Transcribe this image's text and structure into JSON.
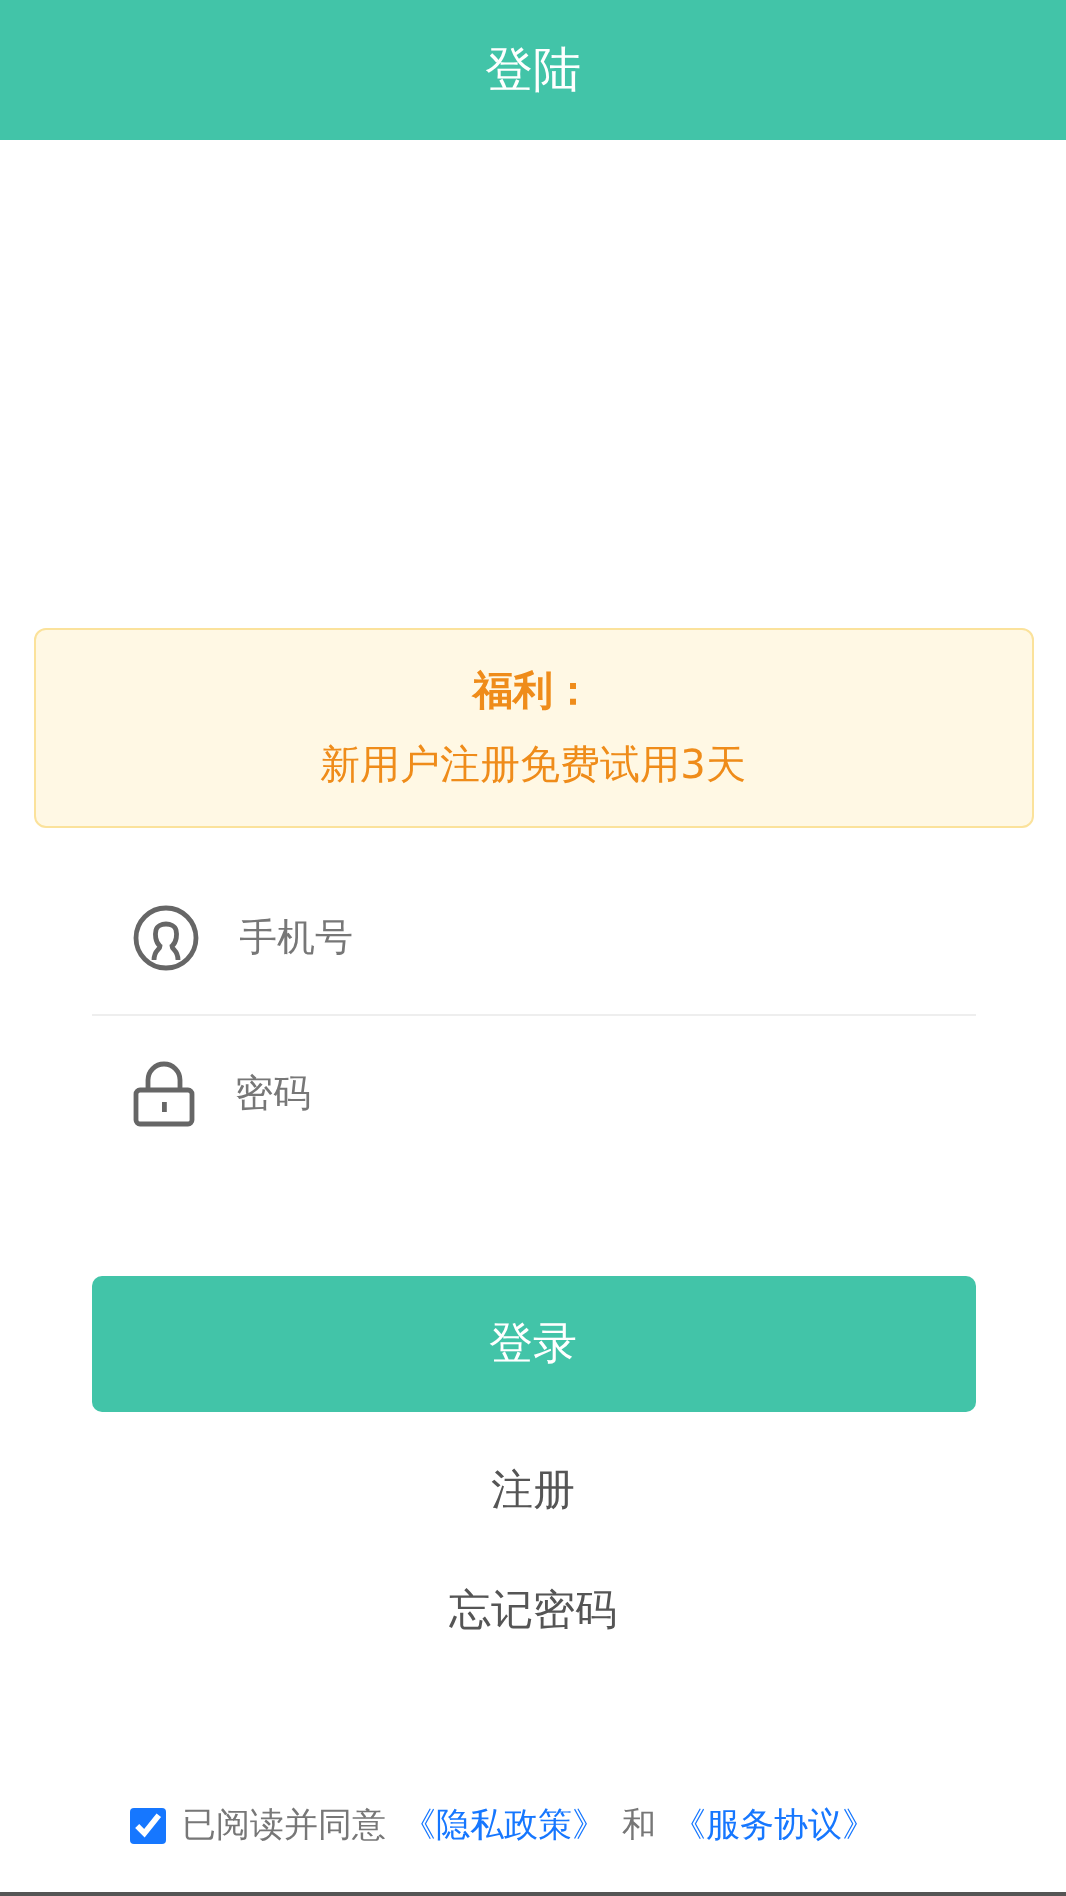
{
  "header": {
    "title": "登陆"
  },
  "notice": {
    "title": "福利：",
    "text": "新用户注册免费试用3天"
  },
  "fields": [
    {
      "kind": "phone",
      "placeholder": "手机号"
    },
    {
      "kind": "password",
      "placeholder": "密码"
    }
  ],
  "login_button": "登录",
  "links": [
    "注册",
    "忘记密码"
  ],
  "agreement": {
    "checked": true,
    "text": "已阅读并同意",
    "policy_link": "《隐私政策》",
    "conjunction": "和",
    "terms_link": "《服务协议》"
  }
}
